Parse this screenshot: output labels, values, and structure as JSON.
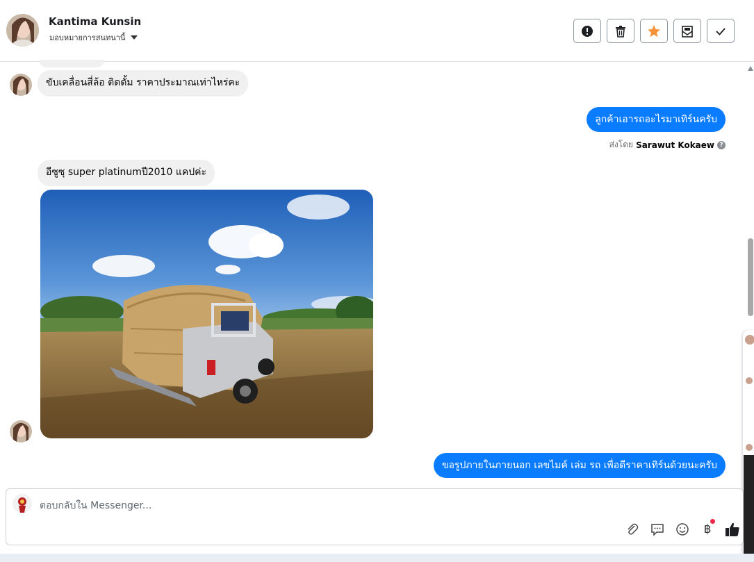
{
  "header": {
    "contact_name": "Kantima Kunsin",
    "assign_label": "มอบหมายการสนทนานี้",
    "actions": [
      {
        "name": "report-button",
        "icon": "exclamation-icon"
      },
      {
        "name": "delete-button",
        "icon": "trash-icon"
      },
      {
        "name": "star-button",
        "icon": "star-icon",
        "color": "#f7923b"
      },
      {
        "name": "move-to-inbox-button",
        "icon": "mail-icon"
      },
      {
        "name": "mark-done-button",
        "icon": "check-icon"
      }
    ]
  },
  "messages": [
    {
      "id": "m1",
      "direction": "in",
      "text": "ขับเคลื่อนสี่ล้อ ติดดั้ม ราคาประมาณเท่าไหร่คะ"
    },
    {
      "id": "m2",
      "direction": "out",
      "text": "ลูกค้าเอารถอะไรมาเทิร์นครับ",
      "sent_by_prefix": "ส่งโดย",
      "sent_by_name": "Sarawut Kokaew"
    },
    {
      "id": "m3",
      "direction": "in",
      "text": "อีซูซุ super platinumปี2010 แคปค่ะ"
    },
    {
      "id": "m4",
      "direction": "in",
      "type": "photo",
      "description_icon": "pickup-truck-with-hay-photo"
    },
    {
      "id": "m5",
      "direction": "out",
      "text": "ขอรูปภายในภายนอก เลขไมค์ เล่ม รถ เพื่อดีราคาเทิร์นด้วยนะครับ"
    }
  ],
  "composer": {
    "placeholder": "ตอบกลับใน Messenger...",
    "tools": [
      "paperclip-icon",
      "saved-replies-icon",
      "emoji-icon",
      "baht-icon",
      "thumbs-up-icon"
    ]
  },
  "colors": {
    "outgoing_bubble": "#0a7cff",
    "incoming_bubble": "#f0f0f0",
    "star": "#f7923b",
    "notification_dot": "#f02849"
  }
}
